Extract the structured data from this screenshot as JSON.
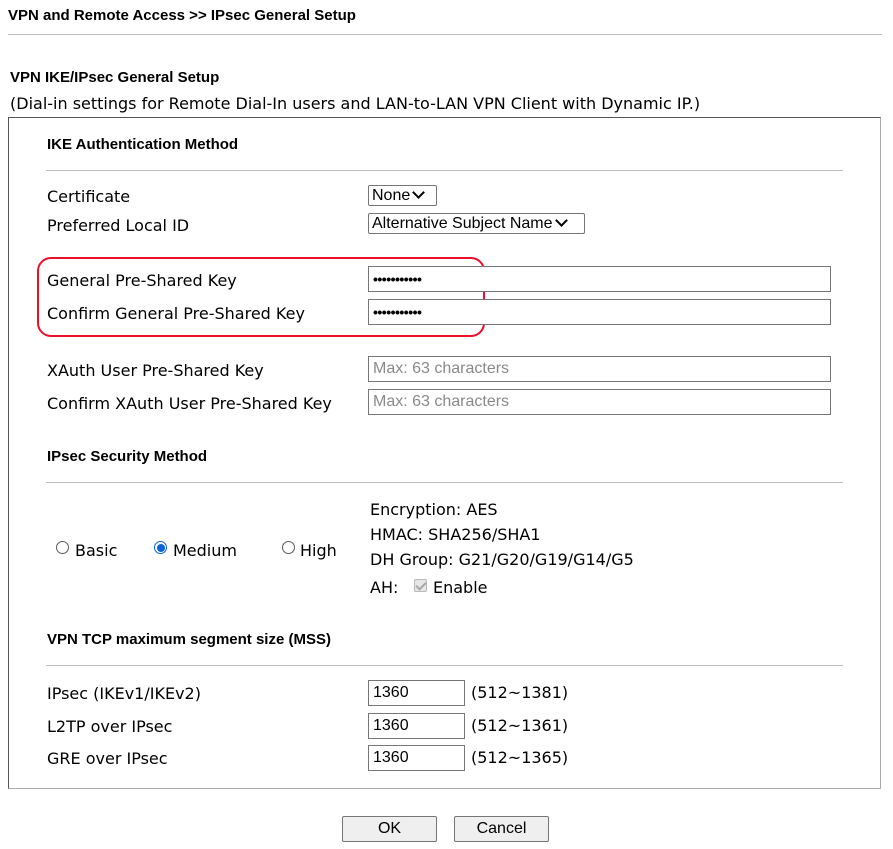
{
  "breadcrumb": "VPN and Remote Access >> IPsec General Setup",
  "section_title": "VPN IKE/IPsec General Setup",
  "section_subtitle": "(Dial-in settings for Remote Dial-In users and LAN-to-LAN VPN Client with Dynamic IP.)",
  "ike": {
    "heading": "IKE Authentication Method",
    "certificate_label": "Certificate",
    "certificate_value": "None",
    "preferred_local_id_label": "Preferred Local ID",
    "preferred_local_id_value": "Alternative Subject Name",
    "general_psk_label": "General Pre-Shared Key",
    "general_psk_value": "•••••••••••",
    "confirm_general_psk_label": "Confirm General Pre-Shared Key",
    "confirm_general_psk_value": "•••••••••••",
    "xauth_psk_label": "XAuth User Pre-Shared Key",
    "xauth_psk_placeholder": "Max: 63 characters",
    "confirm_xauth_psk_label": "Confirm XAuth User Pre-Shared Key",
    "confirm_xauth_psk_placeholder": "Max: 63 characters"
  },
  "security": {
    "heading": "IPsec Security Method",
    "options": [
      "Basic",
      "Medium",
      "High"
    ],
    "selected": "Medium",
    "encryption": "Encryption: AES",
    "hmac": "HMAC: SHA256/SHA1",
    "dh_group": "DH Group: G21/G20/G19/G14/G5",
    "ah_label": "AH:",
    "ah_enable": "Enable",
    "ah_checked": true
  },
  "mss": {
    "heading": "VPN TCP maximum segment size (MSS)",
    "rows": [
      {
        "label": "IPsec (IKEv1/IKEv2)",
        "value": "1360",
        "range": "(512~1381)"
      },
      {
        "label": "L2TP over IPsec",
        "value": "1360",
        "range": "(512~1361)"
      },
      {
        "label": "GRE over IPsec",
        "value": "1360",
        "range": "(512~1365)"
      }
    ]
  },
  "buttons": {
    "ok": "OK",
    "cancel": "Cancel"
  },
  "colors": {
    "highlight": "#e8102a",
    "radio_accent": "#0b63d8"
  }
}
